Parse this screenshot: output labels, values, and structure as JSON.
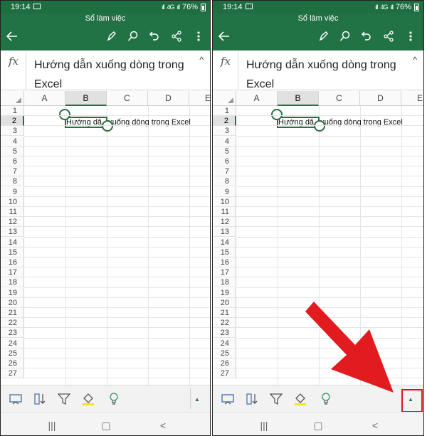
{
  "status": {
    "time": "19:14",
    "battery": "76%",
    "signal": "4G"
  },
  "title_bar": {
    "title": "Sổ làm việc",
    "icons": [
      "back-arrow-icon",
      "pen-icon",
      "search-icon",
      "undo-icon",
      "share-icon",
      "more-vert-icon"
    ]
  },
  "formula_bar": {
    "fx_label": "fx",
    "text_line1": "Hướng dẫn xuống dòng trong",
    "text_line2": "Excel",
    "collapse_glyph": "^"
  },
  "columns": [
    "A",
    "B",
    "C",
    "D",
    "E"
  ],
  "selected_column": "B",
  "rows": [
    "1",
    "2",
    "3",
    "4",
    "5",
    "6",
    "7",
    "8",
    "9",
    "10",
    "11",
    "12",
    "13",
    "14",
    "15",
    "16",
    "17",
    "18",
    "19",
    "20",
    "21",
    "22",
    "23",
    "24",
    "25",
    "26",
    "27"
  ],
  "selected_row": "2",
  "cell_B2": {
    "visible_text": "Hướng dẫ",
    "overflow_text": "xuống dòng trong Excel"
  },
  "bottom_toolbar": {
    "icons": [
      "slideshow-icon",
      "sort-icon",
      "filter-icon",
      "fill-color-icon",
      "lightbulb-icon"
    ],
    "expand_glyph": "▲"
  },
  "nav_bar": {
    "recent_glyph": "|||",
    "home_glyph": "▢",
    "back_glyph": "<"
  },
  "colors": {
    "status_bar": "#1e6e42",
    "title_bar": "#217346",
    "selection": "#217346",
    "highlight": "#e0141b",
    "arrow": "#e21b1e"
  }
}
